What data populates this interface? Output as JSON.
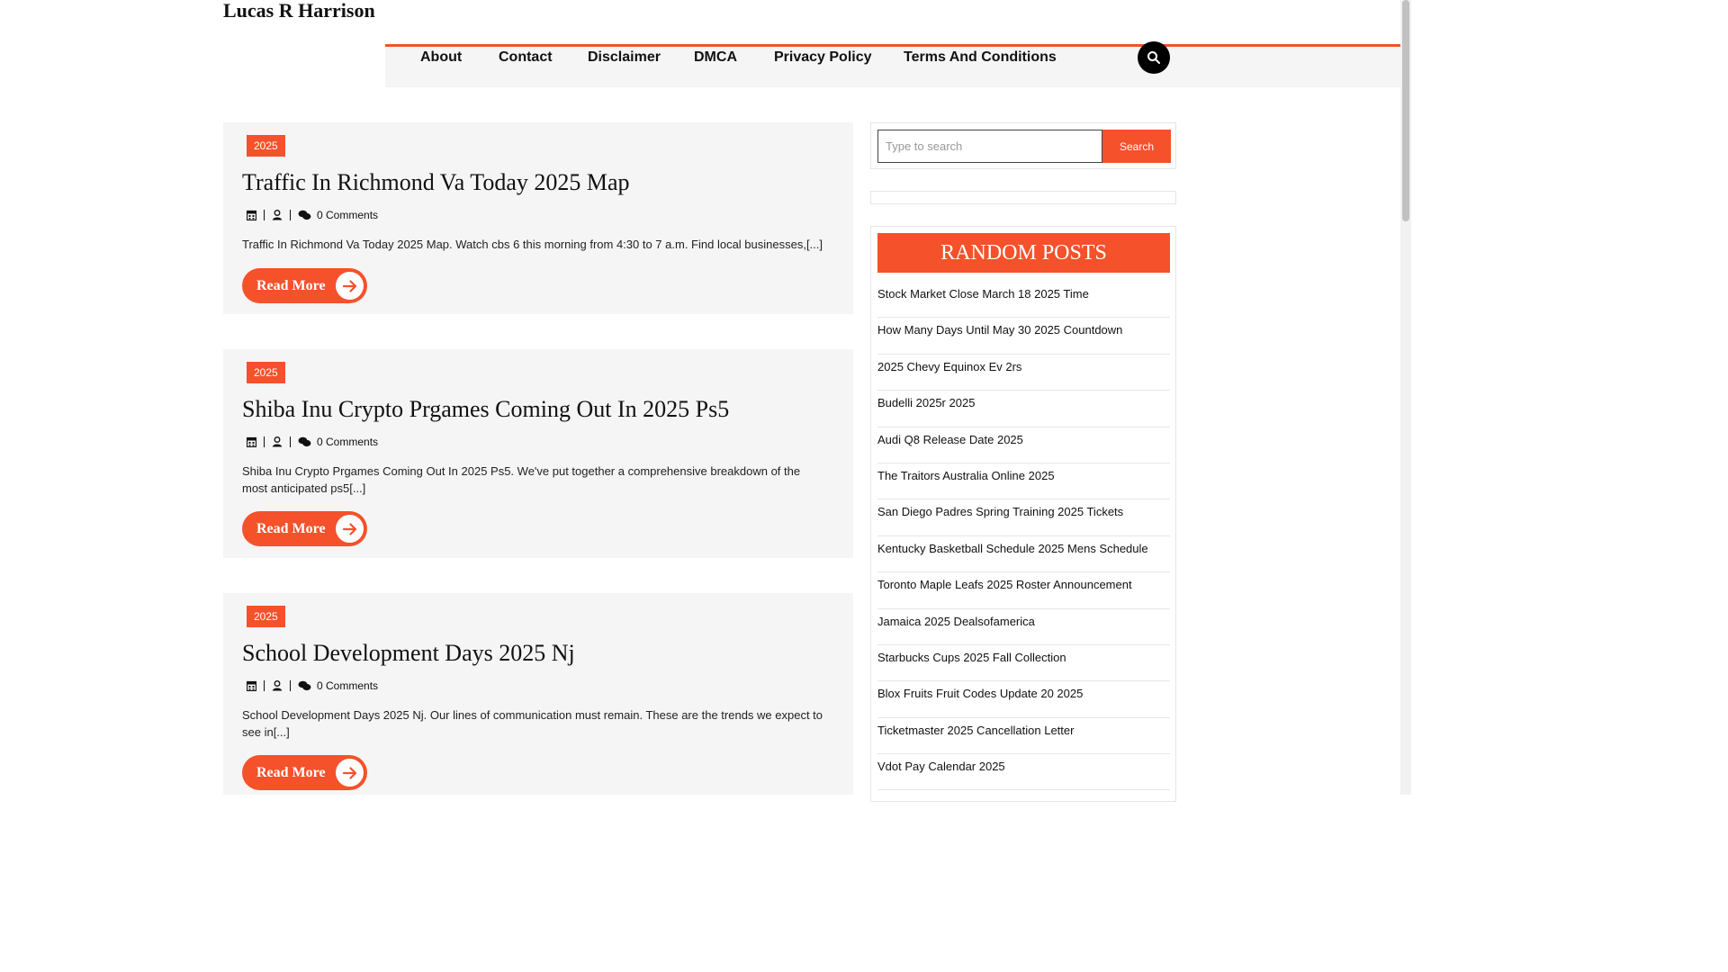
{
  "site": {
    "title": "Lucas R Harrison"
  },
  "nav": {
    "items": [
      {
        "label": "About"
      },
      {
        "label": "Contact"
      },
      {
        "label": "Disclaimer"
      },
      {
        "label": "DMCA"
      },
      {
        "label": "Privacy Policy"
      },
      {
        "label": "Terms And Conditions"
      }
    ]
  },
  "posts": [
    {
      "category": "2025",
      "title": "Traffic In Richmond Va Today 2025 Map",
      "comments": "0 Comments",
      "excerpt": "Traffic In Richmond Va Today 2025 Map. Watch cbs 6 this morning from 4:30 to 7 a.m. Find local businesses,[...]",
      "read_more": "Read More"
    },
    {
      "category": "2025",
      "title": "Shiba Inu Crypto Prgames Coming Out In 2025 Ps5",
      "comments": "0 Comments",
      "excerpt": "Shiba Inu Crypto Prgames Coming Out In 2025 Ps5. We've put together a comprehensive breakdown of the most anticipated ps5[...]",
      "read_more": "Read More"
    },
    {
      "category": "2025",
      "title": "School Development Days 2025 Nj",
      "comments": "0 Comments",
      "excerpt": "School Development Days 2025 Nj. Our lines of communication must remain. These are the trends we expect to see in[...]",
      "read_more": "Read More"
    }
  ],
  "sidebar": {
    "search": {
      "placeholder": "Type to search",
      "button": "Search"
    },
    "random_posts": {
      "heading": "RANDOM POSTS",
      "items": [
        "Stock Market Close March 18 2025 Time",
        "How Many Days Until May 30 2025 Countdown",
        "2025 Chevy Equinox Ev 2rs",
        "Budelli 2025r 2025",
        "Audi Q8 Release Date 2025",
        "The Traitors Australia Online 2025",
        "San Diego Padres Spring Training 2025 Tickets",
        "Kentucky Basketball Schedule 2025 Mens Schedule",
        "Toronto Maple Leafs 2025 Roster Announcement",
        "Jamaica 2025 Dealsofamerica",
        "Starbucks Cups 2025 Fall Collection",
        "Blox Fruits Fruit Codes Update 20 2025",
        "Ticketmaster 2025 Cancellation Letter",
        "Vdot Pay Calendar 2025"
      ]
    }
  },
  "colors": {
    "accent": "#f5512b",
    "panel": "#f5f5f5"
  }
}
